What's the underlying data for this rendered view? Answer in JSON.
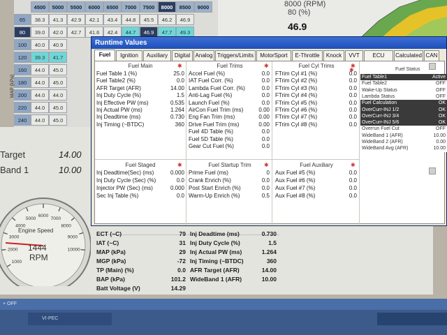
{
  "fuelmap": {
    "axis_label": "MAP (kPa)",
    "columns": [
      "4500",
      "5000",
      "5500",
      "6000",
      "6500",
      "7000",
      "7500",
      "8000",
      "8500",
      "9000"
    ],
    "rows": [
      {
        "kpa": "65",
        "cells": [
          "38.3",
          "41.3",
          "42.9",
          "42.1",
          "43.4",
          "44.8",
          "45.5",
          "46.2",
          "46.9"
        ]
      },
      {
        "kpa": "80",
        "cells": [
          "39.0",
          "42.0",
          "42.7",
          "41.6",
          "42.4",
          "44.7",
          "46.9",
          "47.7",
          "49.3"
        ]
      },
      {
        "kpa": "100",
        "cells": [
          "40.0",
          "40.9"
        ]
      },
      {
        "kpa": "120",
        "cells": [
          "39.3",
          "41.7"
        ]
      },
      {
        "kpa": "160",
        "cells": [
          "44.0",
          "45.0"
        ]
      },
      {
        "kpa": "180",
        "cells": [
          "44.0",
          "45.0"
        ]
      },
      {
        "kpa": "200",
        "cells": [
          "44.0",
          "44.0"
        ]
      },
      {
        "kpa": "220",
        "cells": [
          "44.0",
          "45.0"
        ]
      },
      {
        "kpa": "240",
        "cells": [
          "44.0",
          "45.0"
        ]
      }
    ]
  },
  "plot": {
    "rpm_label": "8000 (RPM)",
    "pct_label": "80 (%)",
    "value": "46.9"
  },
  "dash": {
    "target_label": "Target",
    "target_value": "14.00",
    "wideband_label": "Band 1",
    "wideband_value": "10.00",
    "gauge_title": "Engine Speed",
    "gauge_value": "1444",
    "gauge_unit": "RPM",
    "gauge_ticks": [
      "1000",
      "2000",
      "3000",
      "4000",
      "5000",
      "6000",
      "7000",
      "8000",
      "9000",
      "10000"
    ]
  },
  "dialog": {
    "title": "Runtime Values",
    "tabs": [
      "Fuel",
      "Ignition",
      "Auxiliary",
      "Digital",
      "Analog",
      "Triggers/Limits",
      "MotorSport",
      "E-Throttle",
      "Knock",
      "VVT",
      "ECU Status",
      "Calculated",
      "CAN"
    ],
    "active_tab": "Fuel",
    "fuel_main": {
      "title": "Fuel Main",
      "rows": [
        {
          "label": "Fuel Table 1 (%)",
          "value": "25.0"
        },
        {
          "label": "Fuel Table2 (%)",
          "value": "0.0"
        },
        {
          "label": "AFR Target (AFR)",
          "value": "14.00"
        },
        {
          "label": "Inj Duty Cycle (%)",
          "value": "1.5"
        },
        {
          "label": "Inj Effective PW (ms)",
          "value": "0.535"
        },
        {
          "label": "Inj Actual PW (ms)",
          "value": "1.264"
        },
        {
          "label": "Inj Deadtime (ms)",
          "value": "0.730"
        },
        {
          "label": "Inj Timing (~BTDC)",
          "value": "360"
        }
      ]
    },
    "fuel_trims": {
      "title": "Fuel Trims",
      "rows": [
        {
          "label": "Accel Fuel (%)",
          "value": "0.0"
        },
        {
          "label": "IAT Fuel Corr. (%)",
          "value": "0.0"
        },
        {
          "label": "Lambda Fuel Corr. (%)",
          "value": "0.0"
        },
        {
          "label": "Anti-Lag Fuel (%)",
          "value": "0.0"
        },
        {
          "label": "Launch Fuel (%)",
          "value": "0.0"
        },
        {
          "label": "AirCon Fuel Trim (ms)",
          "value": "0.00"
        },
        {
          "label": "Eng Fan Trim (ms)",
          "value": "0.00"
        },
        {
          "label": "Drive Fuel Trim (ms)",
          "value": "0.00"
        },
        {
          "label": "Fuel 4D Table (%)",
          "value": "0.0"
        },
        {
          "label": "Fuel 5D Table (%)",
          "value": "0.0"
        },
        {
          "label": "Gear Cut Fuel (%)",
          "value": "0.0"
        }
      ]
    },
    "fuel_cyl_trims": {
      "title": "Fuel Cyl Trims",
      "rows": [
        {
          "label": "FTrim Cyl #1 (%)",
          "value": "0.0"
        },
        {
          "label": "FTrim Cyl #2 (%)",
          "value": "0.0"
        },
        {
          "label": "FTrim Cyl #3 (%)",
          "value": "0.0"
        },
        {
          "label": "FTrim Cyl #4 (%)",
          "value": "0.0"
        },
        {
          "label": "FTrim Cyl #5 (%)",
          "value": "0.0"
        },
        {
          "label": "FTrim Cyl #6 (%)",
          "value": "0.0"
        },
        {
          "label": "FTrim Cyl #7 (%)",
          "value": "0.0"
        },
        {
          "label": "FTrim Cyl #8 (%)",
          "value": "0.0"
        }
      ]
    },
    "fuel_status": {
      "title": "Fuel Status",
      "rows": [
        {
          "label": "Fuel Table1",
          "value": "Active",
          "on": true
        },
        {
          "label": "Fuel Table2",
          "value": "OFF",
          "on": false
        },
        {
          "label": "Wake-Up Status",
          "value": "OFF",
          "on": false
        },
        {
          "label": "Lambda Status",
          "value": "OFF",
          "on": false
        },
        {
          "label": "Fuel Calculation",
          "value": "OK",
          "on": true
        },
        {
          "label": "OverCurr-INJ 1/2",
          "value": "OK",
          "on": true
        },
        {
          "label": "OverCurr-INJ 3/4",
          "value": "OK",
          "on": true
        },
        {
          "label": "OverCurr-INJ 5/6",
          "value": "OK",
          "on": true
        },
        {
          "label": "Overrun Fuel Cut",
          "value": "OFF",
          "on": false
        },
        {
          "label": "WideBand 1 (AFR)",
          "value": "10.00",
          "on": false
        },
        {
          "label": "WideBand 2 (AFR)",
          "value": "0.00",
          "on": false
        },
        {
          "label": "WideBand Avg (AFR)",
          "value": "10.00",
          "on": false
        }
      ]
    },
    "fuel_staged": {
      "title": "Fuel Staged",
      "rows": [
        {
          "label": "Inj Deadtime(Sec) (ms)",
          "value": "0.000"
        },
        {
          "label": "Inj Duty Cycle (Sec) (%)",
          "value": "0.0"
        },
        {
          "label": "Injector PW (Sec) (ms)",
          "value": "0.000"
        },
        {
          "label": "Sec Inj Table (%)",
          "value": "0.0"
        }
      ]
    },
    "fuel_startup": {
      "title": "Fuel Startup Trim",
      "rows": [
        {
          "label": "Prime Fuel (ms)",
          "value": "0"
        },
        {
          "label": "Crank Enrich (%)",
          "value": "0.0"
        },
        {
          "label": "Post Start Enrich (%)",
          "value": "0.0"
        },
        {
          "label": "Warm-Up Enrich (%)",
          "value": "0.5"
        }
      ]
    },
    "fuel_auxiliary": {
      "title": "Fuel Auxiliary",
      "rows": [
        {
          "label": "Aux Fuel #5 (%)",
          "value": "0.0"
        },
        {
          "label": "Aux Fuel #6 (%)",
          "value": "0.0"
        },
        {
          "label": "Aux Fuel #7 (%)",
          "value": "0.0"
        },
        {
          "label": "Aux Fuel #8 (%)",
          "value": "0.0"
        }
      ]
    }
  },
  "readouts": {
    "left": [
      {
        "label": "ECT (~C)",
        "value": "79"
      },
      {
        "label": "IAT (~C)",
        "value": "31"
      },
      {
        "label": "MAP (kPa)",
        "value": "29"
      },
      {
        "label": "MGP (kPa)",
        "value": "-72"
      },
      {
        "label": "TP (Main) (%)",
        "value": "0.0"
      },
      {
        "label": "BAP (kPa)",
        "value": "101.2"
      },
      {
        "label": "Batt Voltage (V)",
        "value": "14.29"
      }
    ],
    "right": [
      {
        "label": "Inj Deadtime (ms)",
        "value": "0.730"
      },
      {
        "label": "Inj Duty Cycle (%)",
        "value": "1.5"
      },
      {
        "label": "Inj Actual PW (ms)",
        "value": "1.264"
      },
      {
        "label": "Inj Timing (~BTDC)",
        "value": "360"
      },
      {
        "label": "AFR Target (AFR)",
        "value": "14.00"
      },
      {
        "label": "WideBand 1 (AFR)",
        "value": "10.00"
      }
    ]
  },
  "taskbar": {
    "top_text": "+ OFF",
    "button_label": "VI-PEC"
  }
}
